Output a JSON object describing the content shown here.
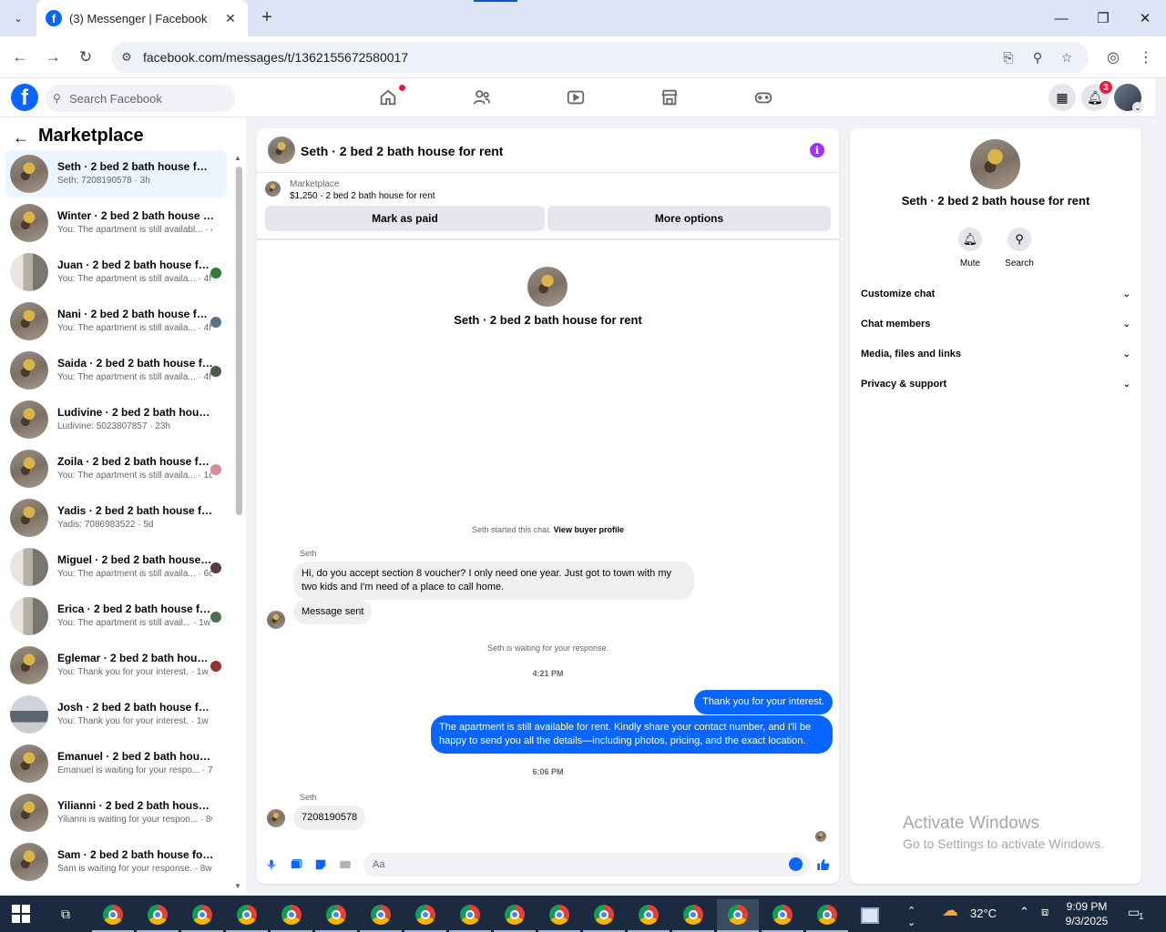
{
  "browser": {
    "tab_title": "(3) Messenger | Facebook",
    "favicon": "f",
    "url": "facebook.com/messages/t/1362155672580017"
  },
  "header": {
    "search_placeholder": "Search Facebook",
    "notification_count": "3",
    "nav_icons": [
      "home-icon",
      "friends-icon",
      "video-icon",
      "marketplace-icon",
      "gaming-icon"
    ]
  },
  "sidebar": {
    "title": "Marketplace",
    "conversations": [
      {
        "name": "Seth · 2 bed 2 bath house for rent",
        "preview": "Seth: 7208190578 · 3h",
        "active": true,
        "mini": ""
      },
      {
        "name": "Winter · 2 bed 2 bath house for rent",
        "preview": "You: The apartment is still availabl... · 4h",
        "active": false,
        "mini": ""
      },
      {
        "name": "Juan · 2 bed 2 bath house for rent",
        "preview": "You: The apartment is still availa... · 4h",
        "active": false,
        "mini": "#2e7d32"
      },
      {
        "name": "Nani · 2 bed 2 bath house for rent",
        "preview": "You: The apartment is still availa... · 4h",
        "active": false,
        "mini": "#5c7087"
      },
      {
        "name": "Saida · 2 bed 2 bath house for rent",
        "preview": "You: The apartment is still availa... · 4h",
        "active": false,
        "mini": "#4e5a4a"
      },
      {
        "name": "Ludivine · 2 bed 2 bath house for rent",
        "preview": "Ludivine: 5023807857 · 23h",
        "active": false,
        "mini": ""
      },
      {
        "name": "Zoila · 2 bed 2 bath house for rent",
        "preview": "You: The apartment is still availa... · 1d",
        "active": false,
        "mini": "#d98a96"
      },
      {
        "name": "Yadis · 2 bed 2 bath house for rent",
        "preview": "Yadis: 7086983522 · 5d",
        "active": false,
        "mini": ""
      },
      {
        "name": "Miguel · 2 bed 2 bath house for rent",
        "preview": "You: The apartment is still availa... · 6d",
        "active": false,
        "mini": "#5a3c3c"
      },
      {
        "name": "Erica · 2 bed 2 bath house for rent",
        "preview": "You: The apartment is still avail... · 1w",
        "active": false,
        "mini": "#4f6f4f"
      },
      {
        "name": "Eglemar · 2 bed 2 bath house for rent",
        "preview": "You: Thank you for your interest. · 1w",
        "active": false,
        "mini": "#9c2f2f"
      },
      {
        "name": "Josh · 2 bed 2 bath house for rent",
        "preview": "You: Thank you for your interest. · 1w",
        "active": false,
        "mini": ""
      },
      {
        "name": "Emanuel · 2 bed 2 bath house for rent",
        "preview": "Emanuel is waiting for your respo... · 7w",
        "active": false,
        "mini": ""
      },
      {
        "name": "Yilianni · 2 bed 2 bath house for rent",
        "preview": "Yilianni is waiting for your respon... · 8w",
        "active": false,
        "mini": ""
      },
      {
        "name": "Sam · 2 bed 2 bath house for rent",
        "preview": "Sam is waiting for your response. · 8w",
        "active": false,
        "mini": ""
      }
    ]
  },
  "chat": {
    "title": "Seth · 2 bed 2 bath house for rent",
    "marketplace_label": "Marketplace",
    "listing": "$1,250 - 2 bed 2 bath house for rent",
    "mark_paid": "Mark as paid",
    "more_options": "More options",
    "center_name": "Seth · 2 bed 2 bath house for rent",
    "started_note": "Seth started this chat.",
    "view_profile": "View buyer profile",
    "sender1": "Seth",
    "msg1": "Hi, do you accept section 8 voucher? I only need one year. Just got to town with my two kids and I'm need of a place to call home.",
    "msg2": "Message sent",
    "waiting_note": "Seth is waiting for your response.",
    "time1": "4:21 PM",
    "out1": "Thank you for your interest.",
    "out2": "The apartment is still available for rent. Kindly share your contact number, and I'll be happy to send you all the details—including photos, pricing, and the exact location.",
    "time2": "6:06 PM",
    "sender2": "Seth",
    "msg3": "7208190578",
    "composer_placeholder": "Aa"
  },
  "info": {
    "name": "Seth · 2 bed 2 bath house for rent",
    "mute": "Mute",
    "search": "Search",
    "rows": [
      "Customize chat",
      "Chat members",
      "Media, files and links",
      "Privacy & support"
    ]
  },
  "watermark": {
    "line1": "Activate Windows",
    "line2": "Go to Settings to activate Windows."
  },
  "taskbar": {
    "temperature": "32°C",
    "time": "9:09 PM",
    "date": "9/3/2025",
    "notification_count": "1"
  },
  "colors": {
    "fb_blue": "#0866ff",
    "accent_purple": "#a033ff"
  }
}
